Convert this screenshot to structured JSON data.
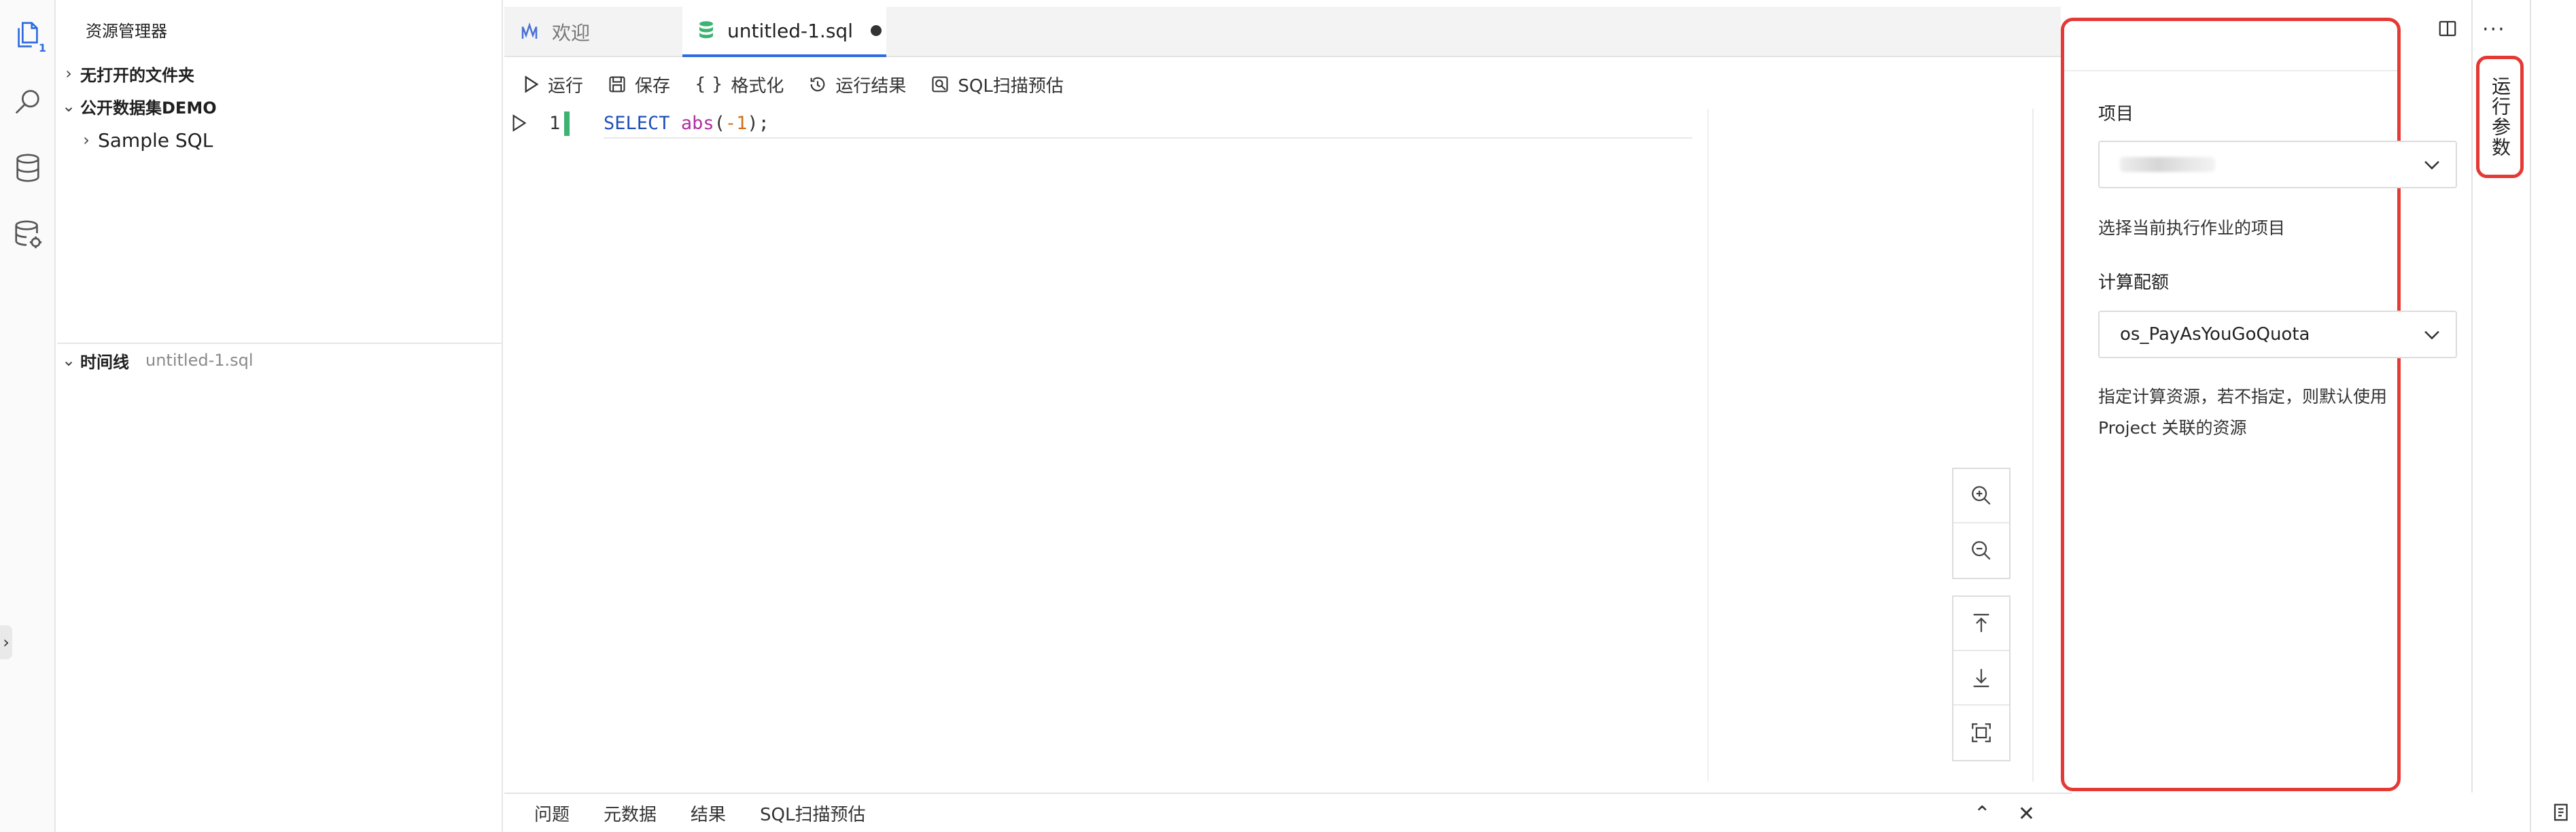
{
  "activity_bar": {
    "explorer_badge": "1",
    "icons": [
      "files-icon",
      "search-icon",
      "database-icon",
      "database-settings-icon"
    ]
  },
  "sidebar": {
    "title": "资源管理器",
    "no_folder": "无打开的文件夹",
    "dataset_section": "公开数据集DEMO",
    "sample_sql": "Sample SQL",
    "timeline_label": "时间线",
    "timeline_file": "untitled-1.sql"
  },
  "tabs": [
    {
      "label": "欢迎"
    },
    {
      "label": "untitled-1.sql"
    }
  ],
  "toolbar": {
    "run": "运行",
    "save": "保存",
    "format": "格式化",
    "run_results": "运行结果",
    "sql_scan": "SQL扫描预估"
  },
  "editor": {
    "line_number": "1",
    "code_keyword": "SELECT",
    "code_function": "abs",
    "code_open": "(",
    "code_number": "-1",
    "code_close": ");"
  },
  "bottom_panel": {
    "tabs": [
      "问题",
      "元数据",
      "结果",
      "SQL扫描预估"
    ]
  },
  "run_params": {
    "project_label": "项目",
    "project_value": "",
    "project_help": "选择当前执行作业的项目",
    "quota_label": "计算配额",
    "quota_value": "os_PayAsYouGoQuota",
    "quota_help_line1": "指定计算资源，若不指定，则默认使用",
    "quota_help_line2": "Project 关联的资源",
    "vertical_tab": "运行参数"
  },
  "colors": {
    "accent": "#2d6cdf",
    "highlight_border": "#e53935",
    "modified_line": "#3cb371"
  }
}
